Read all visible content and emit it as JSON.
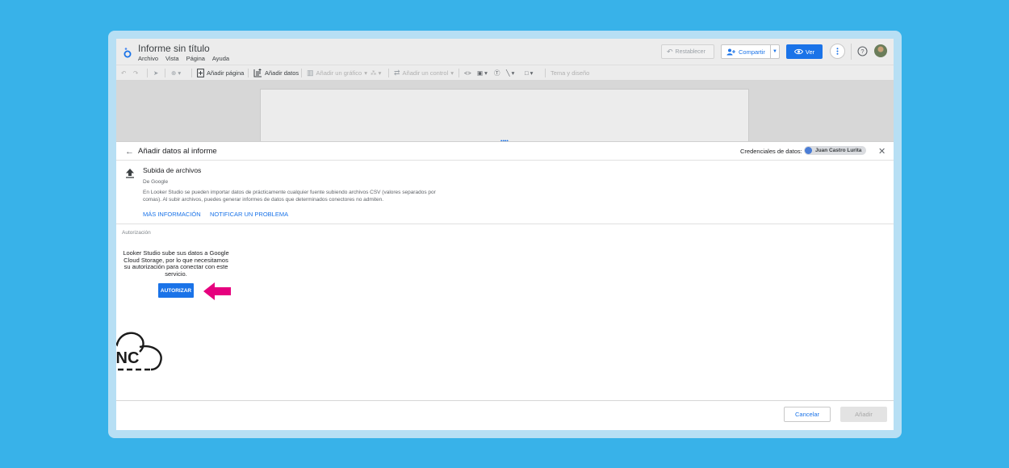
{
  "app": {
    "title": "Informe sin título",
    "menu": [
      "Archivo",
      "Vista",
      "Página",
      "Ayuda"
    ]
  },
  "header": {
    "reset_label": "Restablecer",
    "share_label": "Compartir",
    "view_label": "Ver"
  },
  "toolbar": {
    "add_page": "Añadir página",
    "add_data": "Añadir datos",
    "add_chart": "Añadir un gráfico",
    "add_control": "Añadir un control",
    "theme": "Tema y diseño"
  },
  "panel": {
    "title": "Añadir datos al informe",
    "credentials_label": "Credenciales de datos:",
    "credentials_user": "Juan Castro Lurita"
  },
  "connector": {
    "name": "Subida de archivos",
    "by": "De Google",
    "description": "En Looker Studio se pueden importar datos de prácticamente cualquier fuente subiendo archivos CSV (valores separados por comas). Al subir archivos, puedes generar informes de datos que determinados conectores no admiten.",
    "link_more": "MÁS INFORMACIÓN",
    "link_report": "NOTIFICAR UN PROBLEMA"
  },
  "auth": {
    "section_label": "Autorización",
    "text": "Looker Studio sube sus datos a Google Cloud Storage, por lo que necesitamos su autorización para conectar con este servicio.",
    "button": "AUTORIZAR"
  },
  "footer": {
    "cancel": "Cancelar",
    "add": "Añadir"
  },
  "watermark": {
    "logo_text": "NC"
  },
  "colors": {
    "background": "#38b2e9",
    "accent": "#1a73e8",
    "arrow": "#e6007e"
  }
}
